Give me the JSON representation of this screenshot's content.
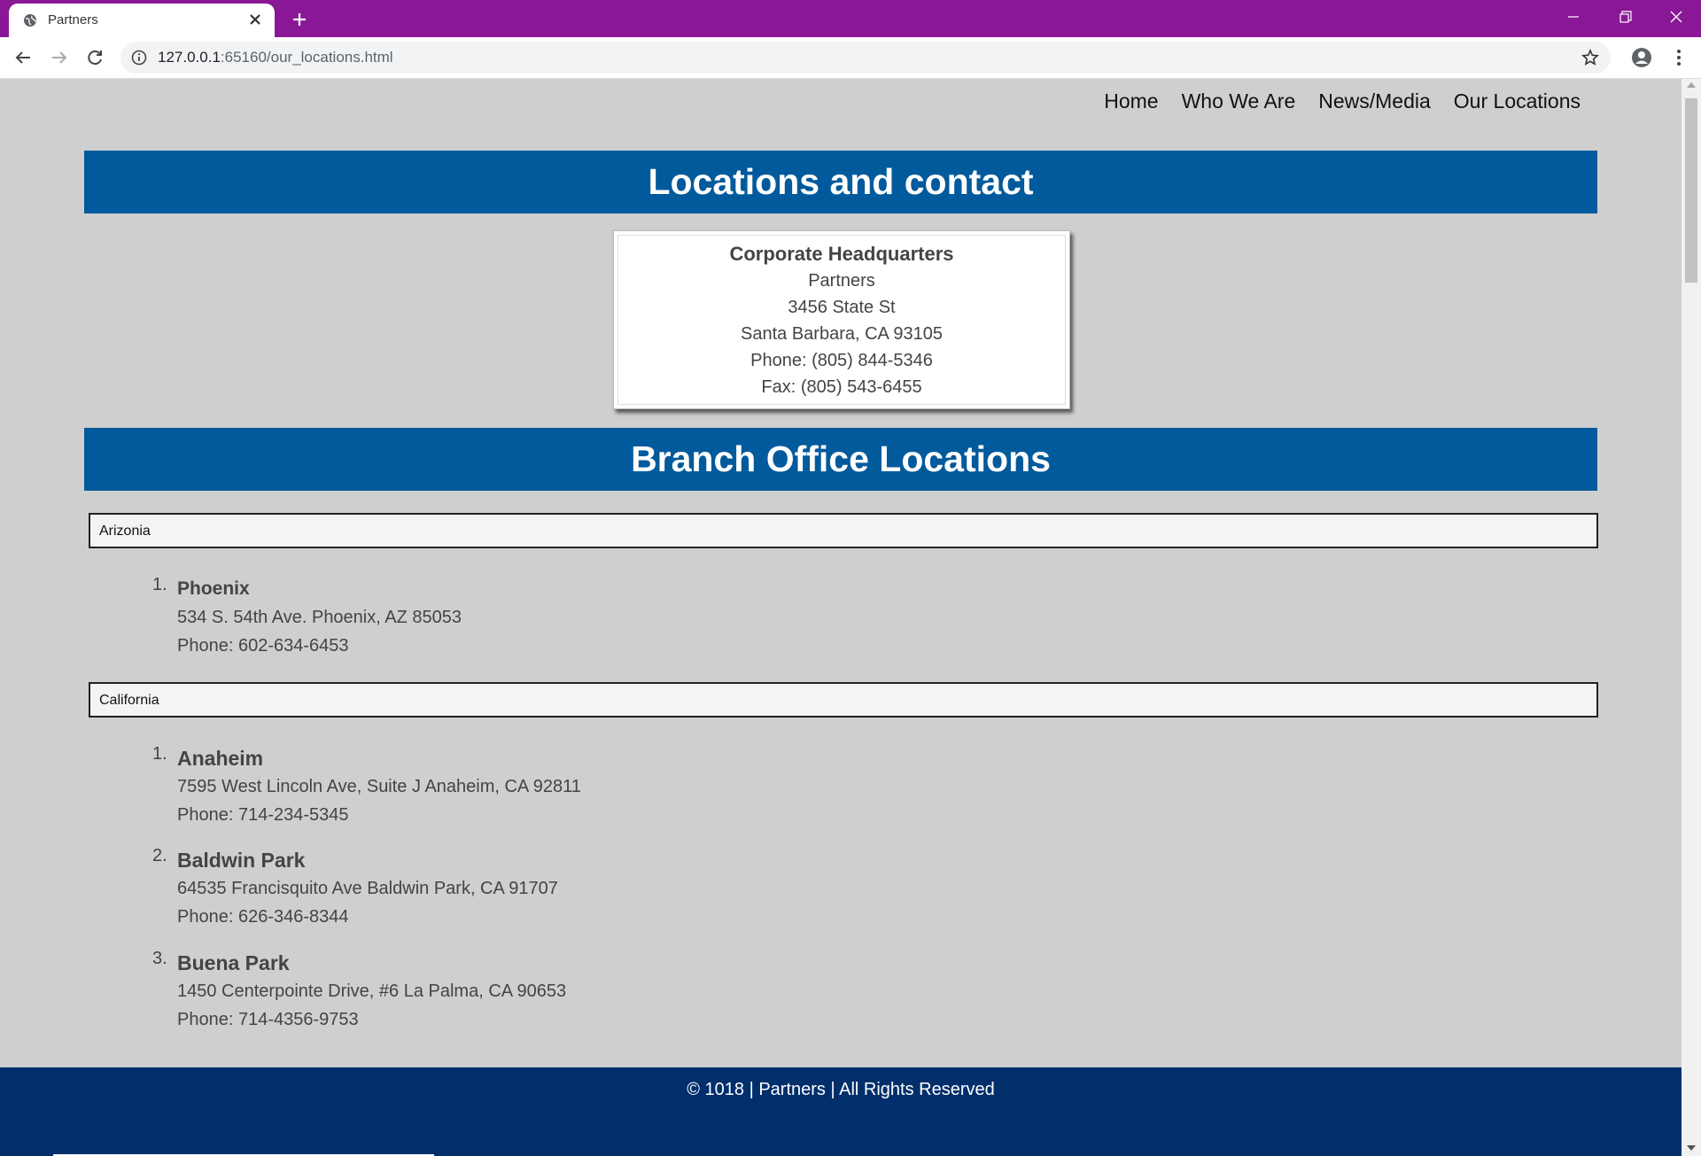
{
  "browser": {
    "tab_title": "Partners",
    "url_host": "127.0.0.1",
    "url_rest": ":65160/our_locations.html"
  },
  "nav": {
    "items": [
      "Home",
      "Who We Are",
      "News/Media",
      "Our Locations"
    ]
  },
  "page": {
    "heading": "Locations and contact",
    "hq": {
      "title": "Corporate Headquarters",
      "company": "Partners",
      "street": "3456 State St",
      "city": "Santa Barbara, CA 93105",
      "phone": "Phone: (805) 844-5346",
      "fax": "Fax: (805) 543-6455"
    },
    "branch_heading": "Branch Office Locations",
    "states": [
      {
        "name": "Arizonia",
        "locations": [
          {
            "num": "1.",
            "name": "Phoenix",
            "address": "534 S. 54th Ave. Phoenix, AZ 85053",
            "phone": "Phone: 602-634-6453"
          }
        ]
      },
      {
        "name": "California",
        "locations": [
          {
            "num": "1.",
            "name": "Anaheim",
            "address": "7595 West Lincoln Ave, Suite J Anaheim, CA 92811",
            "phone": "Phone: 714-234-5345"
          },
          {
            "num": "2.",
            "name": "Baldwin Park",
            "address": "64535 Francisquito Ave Baldwin Park, CA 91707",
            "phone": "Phone: 626-346-8344"
          },
          {
            "num": "3.",
            "name": "Buena Park",
            "address": "1450 Centerpointe Drive, #6 La Palma, CA 90653",
            "phone": "Phone: 714-4356-9753"
          }
        ]
      }
    ],
    "footer": "© 1018 | Partners | All Rights Reserved"
  },
  "colors": {
    "browser_frame": "#891796",
    "banner": "#005a9c",
    "footer": "#002f6c",
    "page_bg": "#cfcfd0"
  }
}
